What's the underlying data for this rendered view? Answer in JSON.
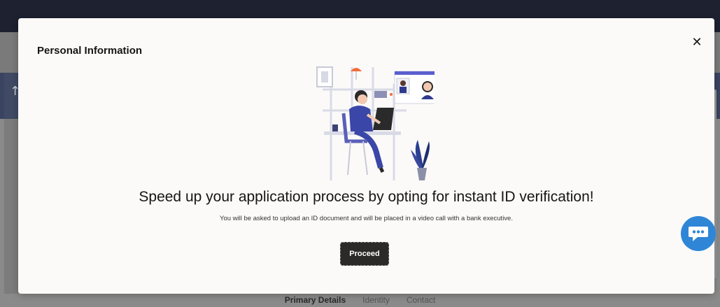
{
  "background": {
    "tabs": [
      {
        "label": "Primary Details",
        "active": true
      },
      {
        "label": "Identity",
        "active": false
      },
      {
        "label": "Contact",
        "active": false
      }
    ]
  },
  "modal": {
    "title": "Personal Information",
    "close_icon": "close-icon",
    "illustration": "video-call-verification-illustration",
    "headline": "Speed up your application process by opting for instant ID verification!",
    "subline": "You will be asked to upload an ID document and will be placed in a video call with a bank executive.",
    "proceed_label": "Proceed"
  },
  "chat": {
    "icon": "chat-bubble-icon"
  },
  "colors": {
    "primary_button": "#2b2a28",
    "chat_fab": "#2f86d6",
    "modal_bg": "#fbfaf9"
  }
}
